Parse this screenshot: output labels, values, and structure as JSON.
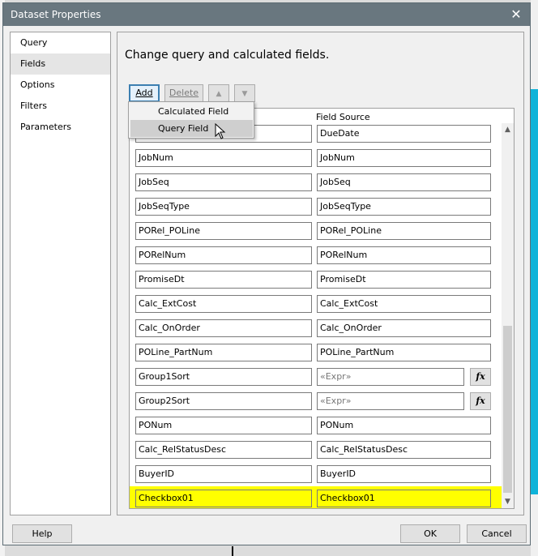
{
  "window": {
    "title": "Dataset Properties",
    "close_symbol": "✕"
  },
  "nav": {
    "items": [
      {
        "label": "Query",
        "active": false
      },
      {
        "label": "Fields",
        "active": true
      },
      {
        "label": "Options",
        "active": false
      },
      {
        "label": "Filters",
        "active": false
      },
      {
        "label": "Parameters",
        "active": false
      }
    ]
  },
  "panel": {
    "title": "Change query and calculated fields."
  },
  "toolbar": {
    "add_label": "Add",
    "delete_label": "Delete",
    "up_symbol": "▲",
    "down_symbol": "▼"
  },
  "grid": {
    "field_source_header": "Field Source",
    "rows": [
      {
        "name": "",
        "source": "DueDate",
        "expr": false,
        "highlight": false
      },
      {
        "name": "JobNum",
        "source": "JobNum",
        "expr": false,
        "highlight": false
      },
      {
        "name": "JobSeq",
        "source": "JobSeq",
        "expr": false,
        "highlight": false
      },
      {
        "name": "JobSeqType",
        "source": "JobSeqType",
        "expr": false,
        "highlight": false
      },
      {
        "name": "PORel_POLine",
        "source": "PORel_POLine",
        "expr": false,
        "highlight": false
      },
      {
        "name": "PORelNum",
        "source": "PORelNum",
        "expr": false,
        "highlight": false
      },
      {
        "name": "PromiseDt",
        "source": "PromiseDt",
        "expr": false,
        "highlight": false
      },
      {
        "name": "Calc_ExtCost",
        "source": "Calc_ExtCost",
        "expr": false,
        "highlight": false
      },
      {
        "name": "Calc_OnOrder",
        "source": "Calc_OnOrder",
        "expr": false,
        "highlight": false
      },
      {
        "name": "POLine_PartNum",
        "source": "POLine_PartNum",
        "expr": false,
        "highlight": false
      },
      {
        "name": "Group1Sort",
        "source": "«Expr»",
        "expr": true,
        "highlight": false
      },
      {
        "name": "Group2Sort",
        "source": "«Expr»",
        "expr": true,
        "highlight": false
      },
      {
        "name": "PONum",
        "source": "PONum",
        "expr": false,
        "highlight": false
      },
      {
        "name": "Calc_RelStatusDesc",
        "source": "Calc_RelStatusDesc",
        "expr": false,
        "highlight": false
      },
      {
        "name": "BuyerID",
        "source": "BuyerID",
        "expr": false,
        "highlight": false
      },
      {
        "name": "Checkbox01",
        "source": "Checkbox01",
        "expr": false,
        "highlight": true
      }
    ],
    "fx_label": "fx",
    "highlight_color": "#ffff00"
  },
  "add_menu": {
    "items": [
      "Calculated Field",
      "Query Field"
    ],
    "hovered": "Query Field"
  },
  "footer": {
    "help_label": "Help",
    "ok_label": "OK",
    "cancel_label": "Cancel"
  },
  "colors": {
    "titlebar": "#69777f",
    "add_focus_border": "#3c7fb1"
  }
}
